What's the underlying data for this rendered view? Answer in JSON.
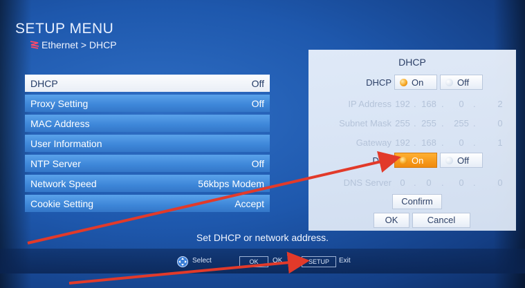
{
  "header": {
    "title": "SETUP MENU",
    "breadcrumb": "Ethernet > DHCP",
    "breadcrumb_icon": "network-icon"
  },
  "menu": {
    "items": [
      {
        "label": "DHCP",
        "value": "Off",
        "selected": true
      },
      {
        "label": "Proxy Setting",
        "value": "Off"
      },
      {
        "label": "MAC Address",
        "value": ""
      },
      {
        "label": "User Information",
        "value": ""
      },
      {
        "label": "NTP Server",
        "value": "Off"
      },
      {
        "label": "Network Speed",
        "value": "56kbps Modem"
      },
      {
        "label": "Cookie Setting",
        "value": "Accept"
      }
    ]
  },
  "panel": {
    "title": "DHCP",
    "dhcp": {
      "label": "DHCP",
      "on": "On",
      "off": "Off",
      "selected": "On"
    },
    "ip": {
      "label": "IP Address",
      "octets": [
        "192",
        "168",
        "0",
        "2"
      ]
    },
    "subnet": {
      "label": "Subnet Mask",
      "octets": [
        "255",
        "255",
        "255",
        "0"
      ]
    },
    "gateway": {
      "label": "Gateway",
      "octets": [
        "192",
        "168",
        "0",
        "1"
      ]
    },
    "dns": {
      "label": "DNS",
      "on": "On",
      "off": "Off",
      "selected": "On"
    },
    "dns_server": {
      "label": "DNS Server",
      "octets": [
        "0",
        "0",
        "0",
        "0"
      ]
    },
    "confirm": "Confirm",
    "ok": "OK",
    "cancel": "Cancel"
  },
  "help_text": "Set DHCP or network address.",
  "footer": {
    "select_label": "Select",
    "ok_key": "OK",
    "ok_label": "OK",
    "setup_key": "SETUP",
    "exit_label": "Exit"
  },
  "colors": {
    "highlight_orange": "#f08a0c",
    "arrow_red": "#e23a2a",
    "background_blue": "#1e58ad"
  }
}
